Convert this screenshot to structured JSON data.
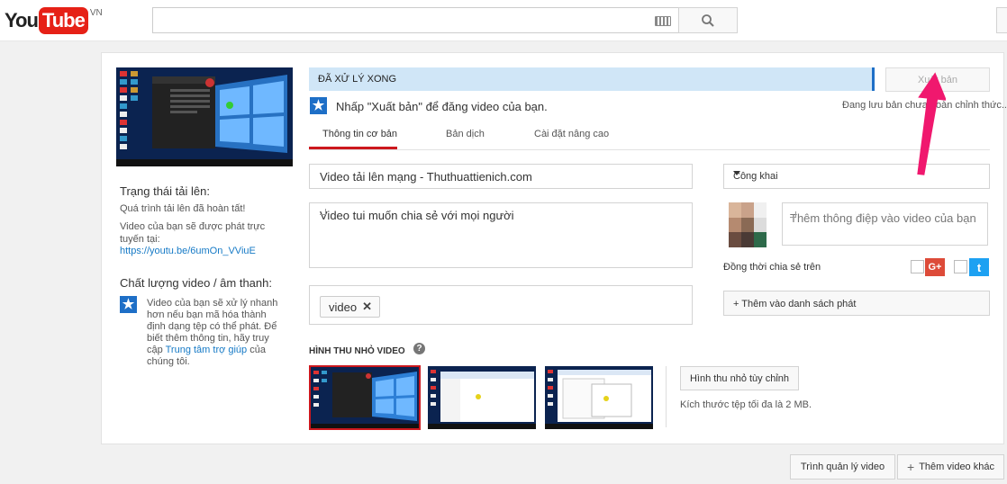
{
  "header": {
    "logo_you": "You",
    "logo_tube": "Tube",
    "logo_region": "VN",
    "search_placeholder": "",
    "icons": {
      "keyboard": "keyboard-icon",
      "search": "search-icon"
    }
  },
  "left": {
    "status_title": "Trạng thái tải lên:",
    "status_complete": "Quá trình tải lên đã hoàn tất!",
    "status_publish_text": "Video của bạn sẽ được phát trực tuyến tại:",
    "video_url": "https://youtu.be/6umOn_VViuE",
    "quality_title": "Chất lượng video / âm thanh:",
    "quality_text": "Video của bạn sẽ xử lý nhanh hơn nếu bạn mã hóa thành định dạng tệp có thể phát. Để biết thêm thông tin, hãy truy cập",
    "quality_link": "Trung tâm trợ giúp",
    "quality_suffix": "của chúng tôi."
  },
  "progress": {
    "label": "ĐÃ XỬ LÝ XONG",
    "value": 1.0
  },
  "publish_button": "Xuất bản",
  "info_text": "Nhấp \"Xuất bản\" để đăng video của bạn.",
  "saving_text": "Đang lưu bản chưa hoàn chỉnh thức...",
  "tabs": [
    {
      "label": "Thông tin cơ bản",
      "active": true
    },
    {
      "label": "Bản dịch",
      "active": false
    },
    {
      "label": "Cài đặt nâng cao",
      "active": false
    }
  ],
  "form": {
    "title": "Video tải lên mạng - Thuthuattienich.com",
    "description": "Video tui muốn chia sẻ với mọi người",
    "tags": [
      "video"
    ],
    "privacy": "Công khai",
    "message_placeholder": "Thêm thông điệp vào video của bạn",
    "share_label": "Đồng thời chia sẻ trên",
    "playlist_button": "+ Thêm vào danh sách phát"
  },
  "thumbnails": {
    "label": "HÌNH THU NHỎ VIDEO",
    "custom_button": "Hình thu nhỏ tùy chỉnh",
    "size_note": "Kích thước tệp tối đa là 2 MB.",
    "selected_index": 0
  },
  "bottom": {
    "manager_button": "Trình quản lý video",
    "more_button": "Thêm video khác"
  },
  "colors": {
    "brand_red": "#e62117",
    "progress_bg": "#d0e6f7",
    "accent_blue": "#1e6fc7",
    "arrow_pink": "#f0186e",
    "gplus": "#dd4b39",
    "twitter": "#1da1f2"
  }
}
